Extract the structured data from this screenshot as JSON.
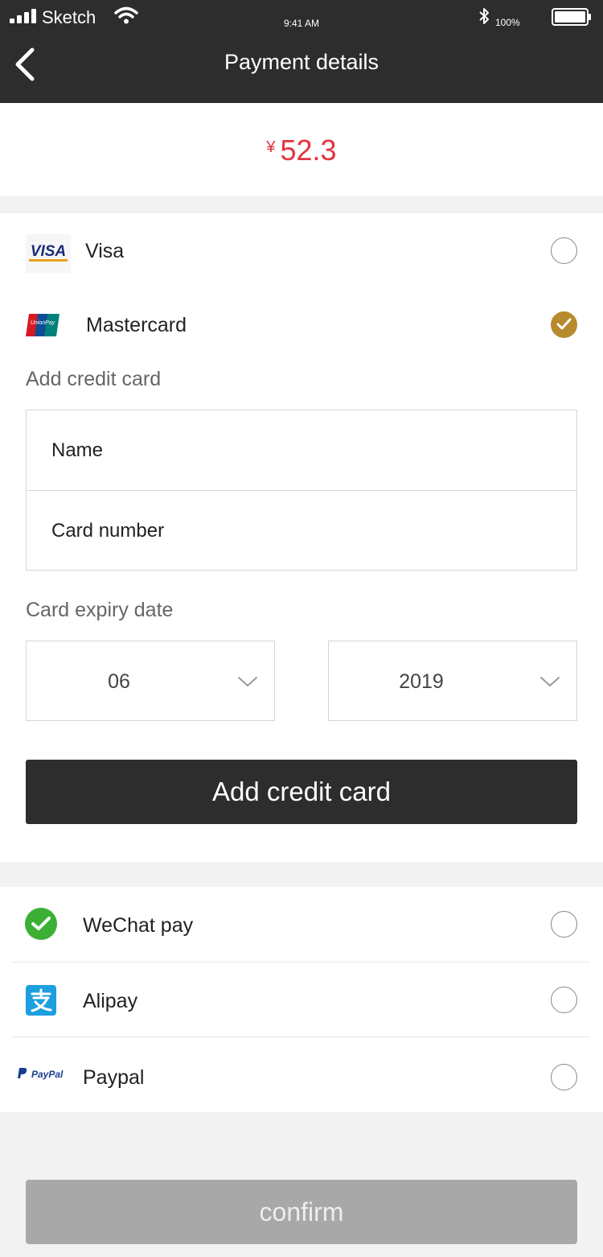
{
  "status_bar": {
    "carrier": "Sketch",
    "time": "9:41 AM",
    "battery": "100%"
  },
  "header": {
    "title": "Payment details",
    "back_icon": "chevron-left-icon"
  },
  "amount": {
    "currency": "¥",
    "value": "52.3",
    "color": "#e2343f"
  },
  "card_options": [
    {
      "label": "Visa",
      "logo": "VISA",
      "selected": false
    },
    {
      "label": "Mastercard",
      "logo": "UnionPay",
      "selected": true
    }
  ],
  "add_card_form": {
    "section_label": "Add credit card",
    "name_label": "Name",
    "card_number_label": "Card number",
    "expiry_label": "Card expiry date",
    "month": "06",
    "year": "2019",
    "button_label": "Add credit card"
  },
  "other_payments": [
    {
      "label": "WeChat pay",
      "icon": "wechat-icon",
      "selected": false
    },
    {
      "label": "Alipay",
      "icon": "alipay-icon",
      "selected": false
    },
    {
      "label": "Paypal",
      "icon": "paypal-icon",
      "logo": "PayPal",
      "selected": false
    }
  ],
  "confirm_label": "confirm",
  "colors": {
    "header_bg": "#2d2d2d",
    "accent_check": "#b88a2e",
    "confirm_disabled": "#a8a8a8"
  }
}
